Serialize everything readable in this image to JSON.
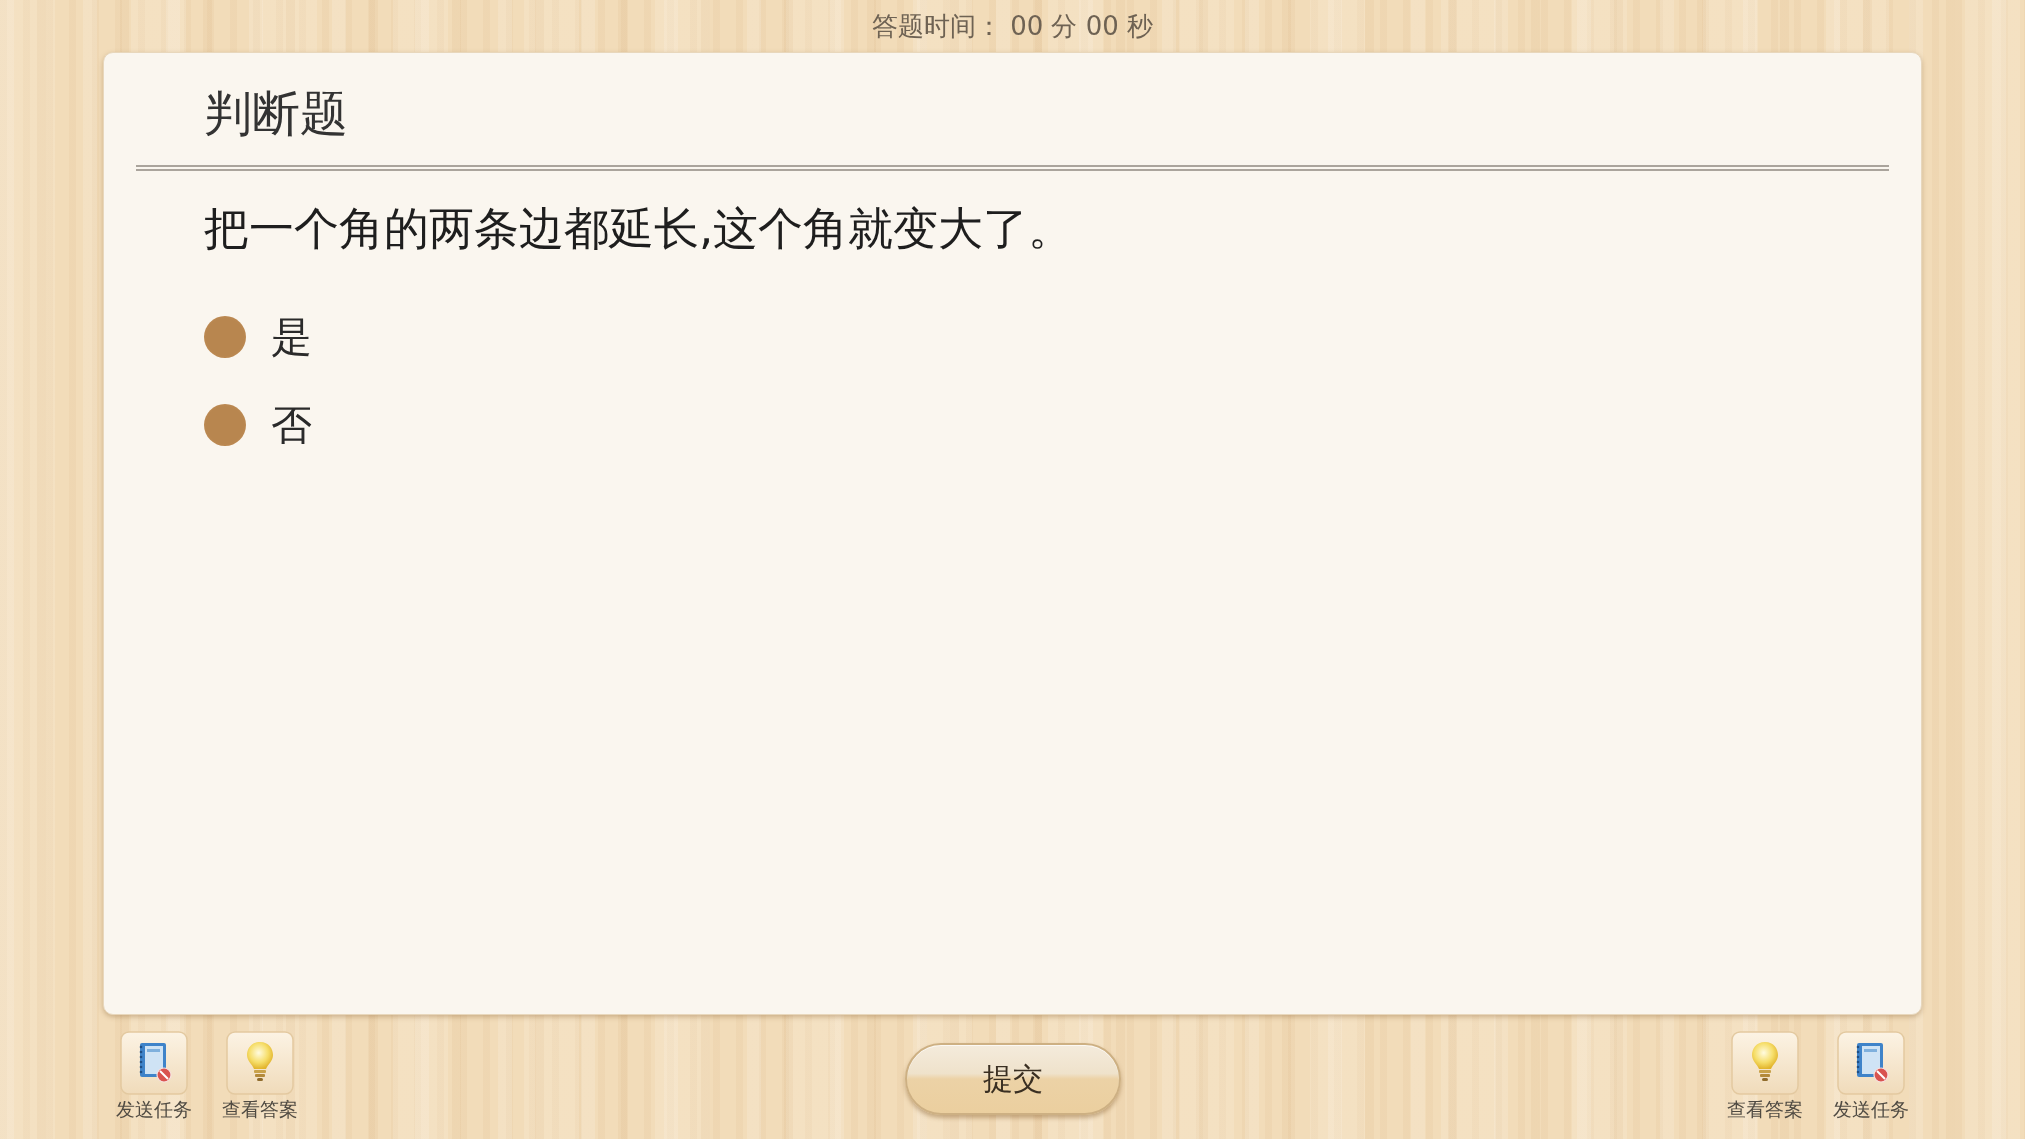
{
  "timer": "答题时间： 00 分 00 秒",
  "question_card": {
    "heading": "判断题",
    "question": "把一个角的两条边都延长,这个角就变大了。",
    "options": [
      {
        "label": "是",
        "selected": false
      },
      {
        "label": "否",
        "selected": false
      }
    ]
  },
  "toolbar_left": [
    {
      "kind": "send-task",
      "label": "发送任务"
    },
    {
      "kind": "view-answer",
      "label": "查看答案"
    }
  ],
  "submit_button": "提交",
  "toolbar_right": [
    {
      "kind": "view-answer",
      "label": "查看答案"
    },
    {
      "kind": "send-task",
      "label": "发送任务"
    }
  ]
}
